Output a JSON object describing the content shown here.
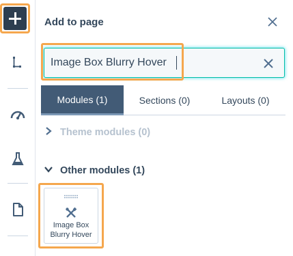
{
  "panel": {
    "title": "Add to page"
  },
  "search": {
    "value": "Image Box Blurry Hover",
    "placeholder": ""
  },
  "tabs": [
    {
      "label": "Modules (1)",
      "active": true
    },
    {
      "label": "Sections (0)",
      "active": false
    },
    {
      "label": "Layouts (0)",
      "active": false
    }
  ],
  "sections": {
    "theme": {
      "label": "Theme modules (0)",
      "expanded": false
    },
    "other": {
      "label": "Other modules (1)",
      "expanded": true
    }
  },
  "modules": [
    {
      "label_line1": "Image Box",
      "label_line2": "Blurry Hover"
    }
  ],
  "rail": {
    "icons": [
      "add-icon",
      "tree-structure-icon",
      "speedometer-icon",
      "flask-icon",
      "document-icon"
    ]
  },
  "colors": {
    "highlight": "#f5a74d",
    "rail_button": "#2d3e50",
    "active_tab": "#425b76",
    "focus_border": "#00bda5",
    "text": "#33475b",
    "muted_text": "#b6c2cf"
  }
}
